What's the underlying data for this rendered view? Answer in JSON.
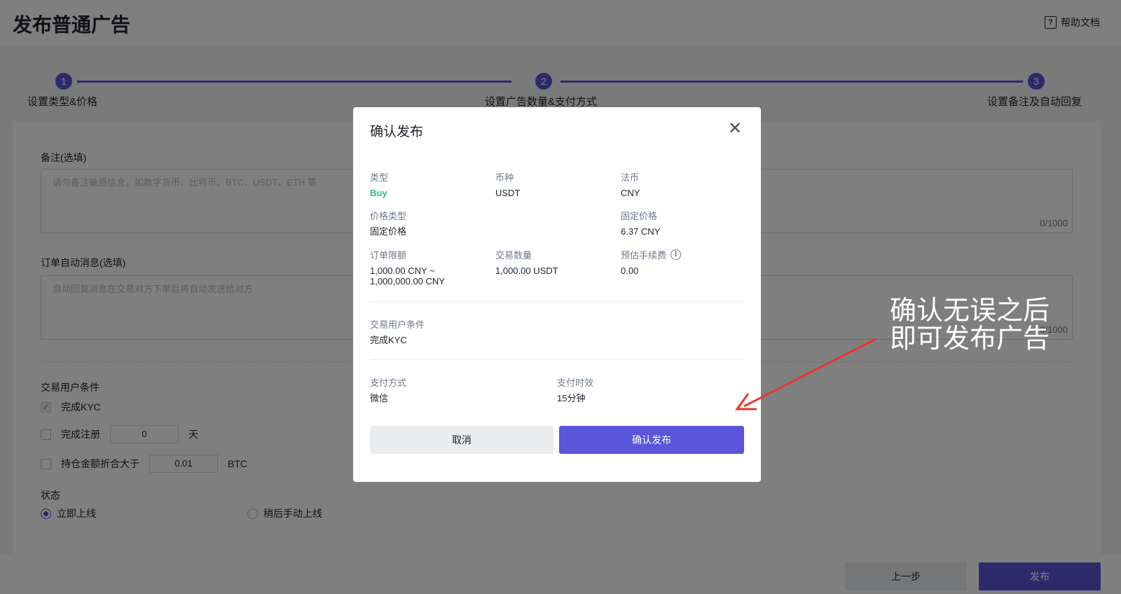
{
  "header": {
    "title": "发布普通广告",
    "help_icon": "?",
    "help_label": "帮助文档"
  },
  "stepper": {
    "steps": [
      {
        "number": "1",
        "label": "设置类型&价格"
      },
      {
        "number": "2",
        "label": "设置广告数量&支付方式"
      },
      {
        "number": "3",
        "label": "设置备注及自动回复"
      }
    ]
  },
  "form": {
    "remark_label": "备注(选填)",
    "remark_placeholder": "请勿备注敏感信息，如数字货币、比特币、BTC、USDT、ETH 等",
    "remark_counter": "0/1000",
    "auto_msg_label": "订单自动消息(选填)",
    "auto_msg_placeholder": "自动回复消息在交易对方下单后将自动发送给对方",
    "auto_msg_counter": "0/1000",
    "conditions_label": "交易用户条件",
    "kyc_label": "完成KYC",
    "kyc_checked": true,
    "register_label": "完成注册",
    "register_value": "0",
    "register_unit": "天",
    "holding_label": "持仓金额折合大于",
    "holding_value": "0.01",
    "holding_unit": "BTC",
    "status_label": "状态",
    "status_online_now": "立即上线",
    "status_online_later": "稍后手动上线"
  },
  "bottom_bar": {
    "prev_label": "上一步",
    "publish_label": "发布"
  },
  "modal": {
    "title": "确认发布",
    "close_glyph": "✕",
    "type_label": "类型",
    "type_value": "Buy",
    "coin_label": "币种",
    "coin_value": "USDT",
    "fiat_label": "法币",
    "fiat_value": "CNY",
    "price_type_label": "价格类型",
    "price_type_value": "固定价格",
    "fixed_price_label": "固定价格",
    "fixed_price_value": "6.37 CNY",
    "order_limit_label": "订单限额",
    "order_limit_value_min": "1,000.00 CNY ~",
    "order_limit_value_max": "1,000,000.00 CNY",
    "trade_amount_label": "交易数量",
    "trade_amount_value": "1,000.00 USDT",
    "est_fee_label": "预估手续费",
    "est_fee_info": "i",
    "est_fee_value": "0.00",
    "user_condition_label": "交易用户条件",
    "user_condition_value": "完成KYC",
    "payment_method_label": "支付方式",
    "payment_method_value": "微信",
    "payment_time_label": "支付时效",
    "payment_time_value": "15分钟",
    "cancel_label": "取消",
    "confirm_label": "确认发布"
  },
  "annotation": {
    "line1": "确认无误之后",
    "line2": "即可发布广告",
    "arrow_color": "#e8382a"
  },
  "colors": {
    "accent": "#5b55d9",
    "buy": "#2ebd85"
  }
}
